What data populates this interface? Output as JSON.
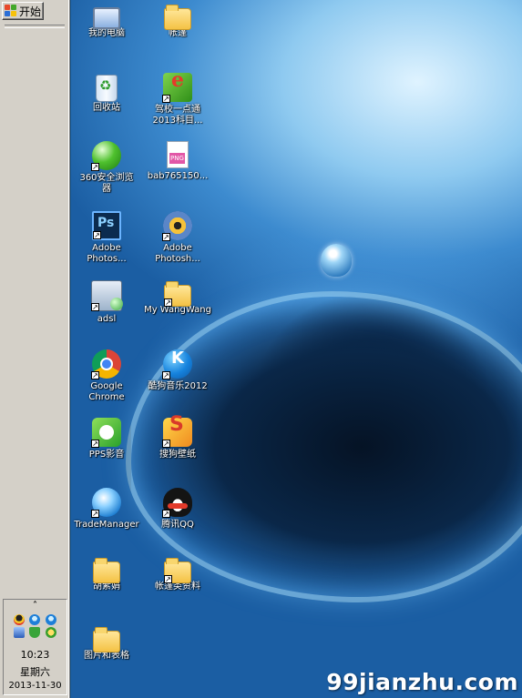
{
  "taskbar": {
    "start_label": "开始",
    "tray": {
      "chevron": "˄",
      "icons": [
        "qq-icon",
        "wangwang-icon",
        "network-icon",
        "security-shield-icon",
        "update-icon"
      ],
      "time": "10:23",
      "weekday": "星期六",
      "date": "2013-11-30"
    }
  },
  "desktop": {
    "icons": [
      {
        "label": "我的电脑",
        "icon": "computer-icon",
        "shortcut": false
      },
      {
        "label": "帐篷",
        "icon": "folder-icon",
        "shortcut": false
      },
      {
        "label": "回收站",
        "icon": "recycle-bin-icon",
        "shortcut": false
      },
      {
        "label": "驾校一点通\n2013科目...",
        "icon": "driving-school-icon",
        "shortcut": true
      },
      {
        "label": "360安全浏览\n器",
        "icon": "360-browser-icon",
        "shortcut": true
      },
      {
        "label": "bab765150...",
        "icon": "png-file-icon",
        "shortcut": false
      },
      {
        "label": "Adobe\nPhotos...",
        "icon": "photoshop-icon",
        "shortcut": true
      },
      {
        "label": "Adobe\nPhotosh...",
        "icon": "photoshop-cd-icon",
        "shortcut": true
      },
      {
        "label": "adsl",
        "icon": "network-connection-icon",
        "shortcut": true
      },
      {
        "label": "My WangWang",
        "icon": "folder-icon",
        "shortcut": true
      },
      {
        "label": "Google\nChrome",
        "icon": "chrome-icon",
        "shortcut": true
      },
      {
        "label": "酷狗音乐2012",
        "icon": "kugou-icon",
        "shortcut": true
      },
      {
        "label": "PPS影音",
        "icon": "pps-icon",
        "shortcut": true
      },
      {
        "label": "搜狗壁纸",
        "icon": "sogou-wallpaper-icon",
        "shortcut": true
      },
      {
        "label": "TradeManager",
        "icon": "trademanager-icon",
        "shortcut": true
      },
      {
        "label": "腾讯QQ",
        "icon": "qq-icon",
        "shortcut": true
      },
      {
        "label": "胡紫娟",
        "icon": "folder-icon",
        "shortcut": false
      },
      {
        "label": "帐篷类资料",
        "icon": "folder-icon",
        "shortcut": true
      },
      {
        "label": "图片和表格",
        "icon": "folder-icon",
        "shortcut": false
      }
    ]
  },
  "watermark": "99jianzhu.com"
}
